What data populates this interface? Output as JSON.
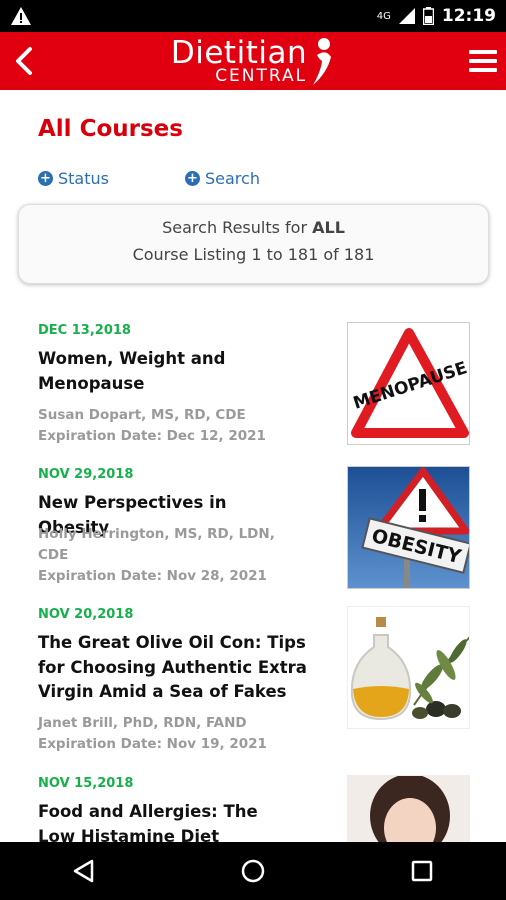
{
  "status_bar": {
    "time": "12:19",
    "network": "4G"
  },
  "app_bar": {
    "logo_main": "Dietitian",
    "logo_sub": "CENTRAL"
  },
  "page": {
    "title": "All Courses",
    "filters": {
      "status_label": "Status",
      "search_label": "Search"
    },
    "results": {
      "prefix": "Search Results for ",
      "query": "ALL",
      "listing": "Course Listing 1 to 181 of 181"
    }
  },
  "courses": [
    {
      "date": "DEC 13,2018",
      "title": "Women, Weight and Menopause",
      "author": "Susan Dopart, MS, RD, CDE",
      "expiration": "Expiration Date: Dec 12, 2021",
      "image_text": "MENOPAUSE"
    },
    {
      "date": "NOV 29,2018",
      "title": "New Perspectives in Obesity",
      "author": "Holly Herrington, MS, RD, LDN, CDE",
      "expiration": "Expiration Date: Nov 28, 2021",
      "image_text": "OBESITY"
    },
    {
      "date": "NOV 20,2018",
      "title": "The Great Olive Oil Con: Tips for Choosing Authentic Extra Virgin Amid a Sea of Fakes",
      "author": "Janet Brill, PhD, RDN, FAND",
      "expiration": "Expiration Date: Nov 19, 2021"
    },
    {
      "date": "NOV 15,2018",
      "title": "Food and Allergies: The Low Histamine Diet"
    }
  ],
  "colors": {
    "brand_red": "#e1000f",
    "title_red": "#d9000d",
    "date_green": "#18b04b",
    "link_blue": "#2b6fb3"
  }
}
